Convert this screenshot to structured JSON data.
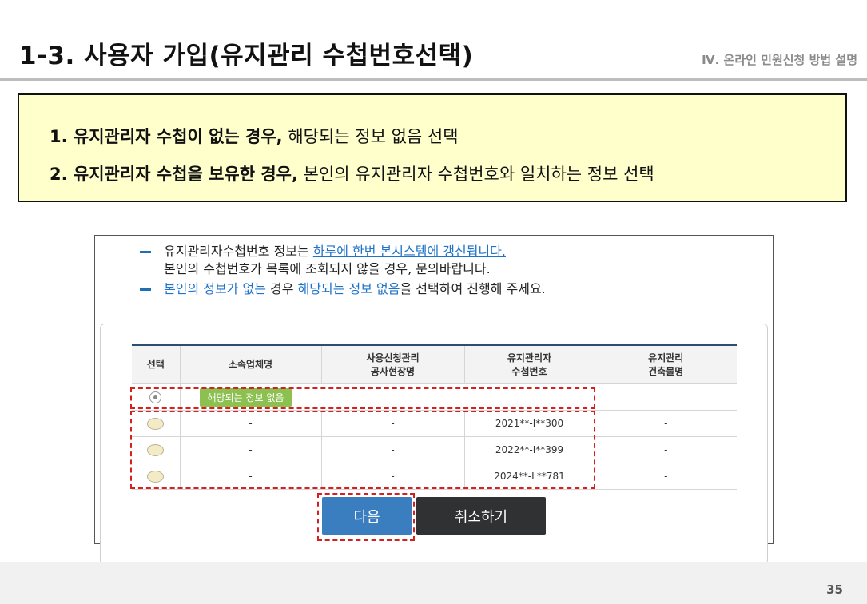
{
  "header": {
    "title": "1-3. 사용자 가입(유지관리 수첩번호선택)",
    "section": "Ⅳ. 온라인 민원신청 방법 설명"
  },
  "notes": [
    {
      "bold": "1. 유지관리자 수첩이 없는 경우,",
      "text": " 해당되는 정보 없음 선택"
    },
    {
      "bold": "2. 유지관리자 수첩을 보유한 경우,",
      "text": " 본인의 유지관리자 수첩번호와 일치하는 정보 선택"
    }
  ],
  "info": {
    "line1_prefix": "유지관리자수첩번호 정보는 ",
    "line1_link": "하루에 한번 본시스템에 갱신됩니다.",
    "line2": "본인의 수첩번호가 목록에 조회되지 않을 경우, 문의바랍니다.",
    "line3_link1": "본인의 정보가 없는",
    "line3_mid": " 경우 ",
    "line3_link2": "해당되는 정보 없음",
    "line3_suffix": "을 선택하여 진행해 주세요."
  },
  "table": {
    "headers": {
      "select": "선택",
      "company": "소속업체명",
      "site_1": "사용신청관리",
      "site_2": "공사현장명",
      "handbook_1": "유지관리자",
      "handbook_2": "수첩번호",
      "building_1": "유지관리",
      "building_2": "건축물명"
    },
    "none_label": "해당되는 정보 없음",
    "rows": [
      {
        "company": "-",
        "site": "-",
        "handbook": "2021**-I**300",
        "building": "-"
      },
      {
        "company": "-",
        "site": "-",
        "handbook": "2022**-I**399",
        "building": "-"
      },
      {
        "company": "-",
        "site": "-",
        "handbook": "2024**-L**781",
        "building": "-"
      }
    ]
  },
  "buttons": {
    "next": "다음",
    "cancel": "취소하기"
  },
  "footer": {
    "page_number": "35"
  },
  "colors": {
    "note_bg": "#ffffcc",
    "link": "#1f73c9",
    "next_button": "#3a7ec0",
    "cancel_button": "#2f3133",
    "highlight": "#d62020",
    "none_badge": "#8cc152"
  }
}
